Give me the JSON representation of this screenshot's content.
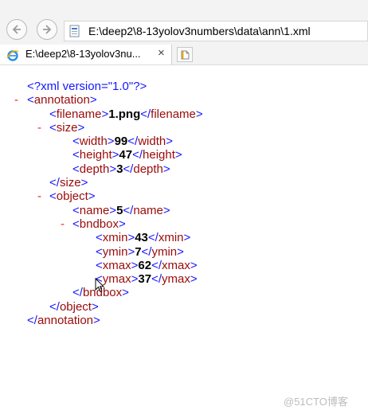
{
  "browser": {
    "address": "E:\\deep2\\8-13yolov3numbers\\data\\ann\\1.xml",
    "tab_title": "E:\\deep2\\8-13yolov3nu...",
    "tab_close": "×"
  },
  "xml": {
    "declaration": "<?xml version=\"1.0\"?>",
    "collapse_marker": "-",
    "tags": {
      "annotation": "annotation",
      "filename": "filename",
      "size": "size",
      "width": "width",
      "height": "height",
      "depth": "depth",
      "object": "object",
      "name": "name",
      "bndbox": "bndbox",
      "xmin": "xmin",
      "ymin": "ymin",
      "xmax": "xmax",
      "ymax": "ymax"
    },
    "values": {
      "filename": "1.png",
      "width": "99",
      "height": "47",
      "depth": "3",
      "name": "5",
      "xmin": "43",
      "ymin": "7",
      "xmax": "62",
      "ymax": "37"
    }
  },
  "watermark": "@51CTO博客",
  "icons": {
    "back": "back-arrow-icon",
    "forward": "forward-arrow-icon",
    "address": "page-icon",
    "favicon": "ie-favicon-icon",
    "new_tab": "new-tab-icon",
    "cursor": "mouse-cursor-icon"
  }
}
